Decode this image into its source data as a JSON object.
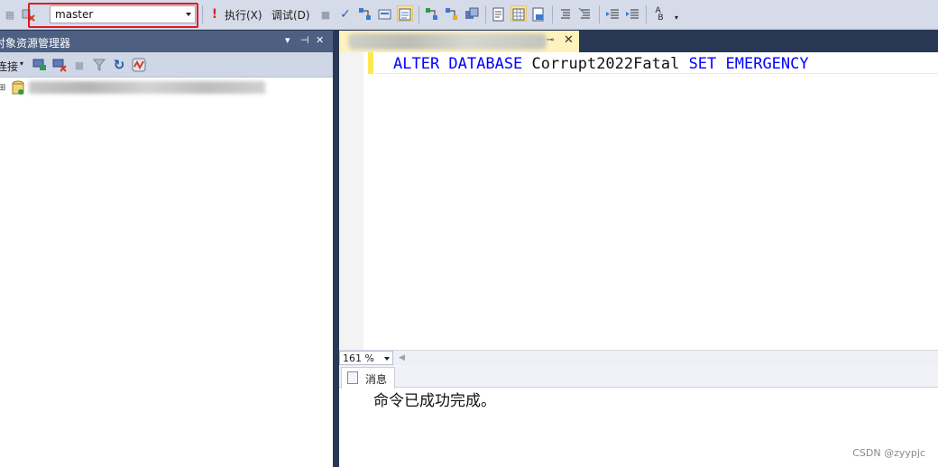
{
  "toolbar": {
    "database": "master",
    "execute_label": "执行(X)",
    "debug_label": "调试(D)"
  },
  "object_explorer": {
    "title": "对象资源管理器",
    "pin_label": "▾ ⊣ ✕",
    "connect_label": "连接"
  },
  "editor": {
    "tab_close": "✕",
    "tab_pin": "⊸",
    "code": {
      "kw1": "ALTER DATABASE",
      "name": "Corrupt2022Fatal",
      "kw2": "SET EMERGENCY"
    },
    "zoom": "161 %"
  },
  "results": {
    "tab_label": "消息",
    "message": "命令已成功完成。"
  },
  "watermark": "CSDN @zyypjc",
  "colors": {
    "keyword": "#0000ff",
    "highlight_box": "#e0181f",
    "panel_title": "#4d6082"
  }
}
